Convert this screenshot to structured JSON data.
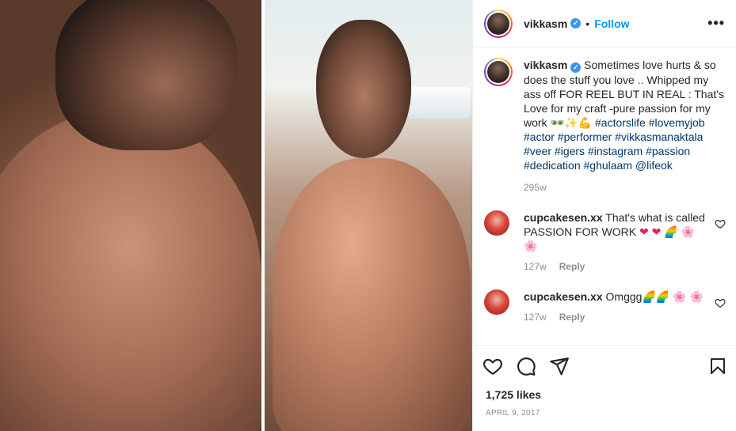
{
  "post": {
    "username": "vikkasm",
    "follow_label": "Follow",
    "separator": "•",
    "more_label": "•••",
    "verified_glyph": "✓"
  },
  "caption": {
    "username": "vikkasm",
    "text": "Sometimes love hurts & so does the stuff you love .. Whipped my ass off FOR REEL BUT IN REAL : That's Love for my craft -pure passion for my work",
    "emojis": [
      "🕶",
      "✨",
      "💪"
    ],
    "hashtags": [
      "#actorslife",
      "#lovemyjob",
      "#actor",
      "#performer",
      "#vikkasmanaktala",
      "#veer",
      "#igers",
      "#instagram",
      "#passion",
      "#dedication",
      "#ghulaam",
      "@lifeok"
    ],
    "time": "295w"
  },
  "comments": [
    {
      "username": "cupcakesen.xx",
      "text": "That's what is called PASSION FOR WORK",
      "emojis": [
        "❤",
        "❤",
        "🌈",
        "🌸",
        "🌸"
      ],
      "time": "127w",
      "reply_label": "Reply"
    },
    {
      "username": "cupcakesen.xx",
      "text": "Omggg",
      "emojis": [
        "🌈",
        "🌈",
        "🌸",
        "🌸"
      ],
      "time": "127w",
      "reply_label": "Reply"
    }
  ],
  "stats": {
    "likes": "1,725 likes",
    "date": "APRIL 9, 2017"
  },
  "colors": {
    "link": "#0095f6",
    "hashtag": "#00376b",
    "muted": "#8e8e8e",
    "text": "#262626"
  },
  "icons": [
    "heart-icon",
    "comment-icon",
    "share-icon",
    "bookmark-icon",
    "more-options-icon",
    "verified-badge-icon"
  ]
}
